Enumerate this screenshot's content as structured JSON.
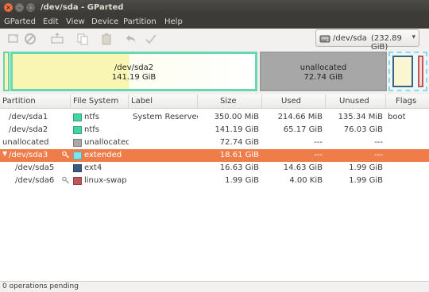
{
  "window": {
    "title": "/dev/sda - GParted"
  },
  "menu": [
    "GParted",
    "Edit",
    "View",
    "Device",
    "Partition",
    "Help"
  ],
  "toolbar": {
    "icons": [
      "new-partition-icon",
      "delete-partition-icon",
      "resize-move-icon",
      "copy-icon",
      "paste-icon",
      "undo-icon",
      "apply-icon"
    ]
  },
  "device": {
    "name": "/dev/sda",
    "size": "(232.89 GiB)"
  },
  "graphic": {
    "sda2": {
      "name": "/dev/sda2",
      "size": "141.19 GiB"
    },
    "unallocated": {
      "name": "unallocated",
      "size": "72.74 GiB"
    }
  },
  "table": {
    "headers": [
      "Partition",
      "File System",
      "Label",
      "Size",
      "Used",
      "Unused",
      "Flags"
    ],
    "rows": [
      {
        "partition": "/dev/sda1",
        "fs": "ntfs",
        "fs_color": "#42d6a4",
        "label": "System Reserved",
        "size": "350.00 MiB",
        "used": "214.66 MiB",
        "unused": "135.34 MiB",
        "flags": "boot"
      },
      {
        "partition": "/dev/sda2",
        "fs": "ntfs",
        "fs_color": "#42d6a4",
        "label": "",
        "size": "141.19 GiB",
        "used": "65.17 GiB",
        "unused": "76.03 GiB",
        "flags": ""
      },
      {
        "partition": "unallocated",
        "fs": "unallocated",
        "fs_color": "#a8a8a8",
        "label": "",
        "size": "72.74 GiB",
        "used": "---",
        "unused": "---",
        "flags": ""
      },
      {
        "partition": "/dev/sda3",
        "fs": "extended",
        "fs_color": "#7fe4ee",
        "label": "",
        "size": "18.61 GiB",
        "used": "---",
        "unused": "---",
        "flags": ""
      },
      {
        "partition": "/dev/sda5",
        "fs": "ext4",
        "fs_color": "#3a5c82",
        "label": "",
        "size": "16.63 GiB",
        "used": "14.63 GiB",
        "unused": "1.99 GiB",
        "flags": ""
      },
      {
        "partition": "/dev/sda6",
        "fs": "linux-swap",
        "fs_color": "#c1565a",
        "label": "",
        "size": "1.99 GiB",
        "used": "4.00 KiB",
        "unused": "1.99 GiB",
        "flags": ""
      }
    ]
  },
  "status": {
    "text": "0 operations pending"
  },
  "colors": {
    "selection": "#ee7d4a",
    "ntfs": "#42d6a4",
    "extended": "#7fe4ee"
  }
}
